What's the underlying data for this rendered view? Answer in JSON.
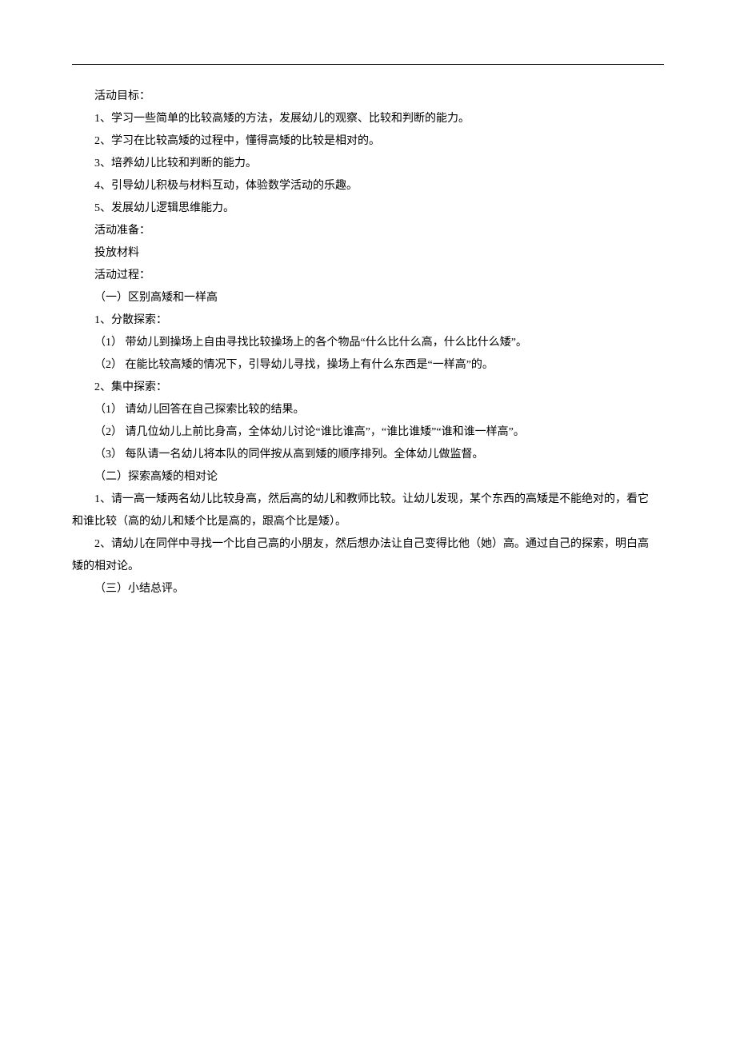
{
  "doc": {
    "sec1_title": "活动目标：",
    "sec1_1": "1、学习一些简单的比较高矮的方法，发展幼儿的观察、比较和判断的能力。",
    "sec1_2": "2、学习在比较高矮的过程中，懂得高矮的比较是相对的。",
    "sec1_3": "3、培养幼儿比较和判断的能力。",
    "sec1_4": "4、引导幼儿积极与材料互动，体验数学活动的乐趣。",
    "sec1_5": "5、发展幼儿逻辑思维能力。",
    "sec2_title": "活动准备：",
    "sec2_1": "投放材料",
    "sec3_title": "活动过程：",
    "sec3_h1": "（一）区别高矮和一样高",
    "sec3_h1_1": "1、分散探索：",
    "sec3_h1_1_1": "（1） 带幼儿到操场上自由寻找比较操场上的各个物品“什么比什么高，什么比什么矮”。",
    "sec3_h1_1_2": "（2） 在能比较高矮的情况下，引导幼儿寻找，操场上有什么东西是“一样高”的。",
    "sec3_h1_2": "2、集中探索：",
    "sec3_h1_2_1": "（1） 请幼儿回答在自己探索比较的结果。",
    "sec3_h1_2_2": "（2） 请几位幼儿上前比身高，全体幼儿讨论“谁比谁高”，“谁比谁矮”“谁和谁一样高”。",
    "sec3_h1_2_3": "（3） 每队请一名幼儿将本队的同伴按从高到矮的顺序排列。全体幼儿做监督。",
    "sec3_h2": "（二）探索高矮的相对论",
    "sec3_h2_1a": "1、请一高一矮两名幼儿比较身高，然后高的幼儿和教师比较。让幼儿发现，某个东西的高矮是不能绝对的，看它",
    "sec3_h2_1b": "和谁比较（高的幼儿和矮个比是高的，跟高个比是矮）。",
    "sec3_h2_2a": "2、请幼儿在同伴中寻找一个比自己高的小朋友，然后想办法让自己变得比他（她）高。通过自己的探索，明白高",
    "sec3_h2_2b": "矮的相对论。",
    "sec3_h3": "（三）小结总评。"
  }
}
